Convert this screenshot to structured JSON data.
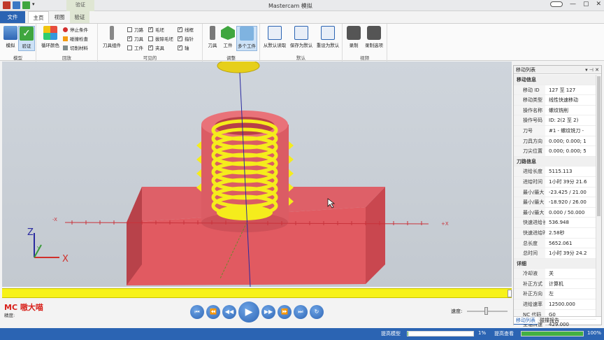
{
  "window": {
    "title": "Mastercam 模拟",
    "context_tab": "验证",
    "controls": [
      "—",
      "▢",
      "✕"
    ]
  },
  "tabs": [
    {
      "label": "文件"
    },
    {
      "label": "主页"
    },
    {
      "label": "视图"
    },
    {
      "label": "验证"
    }
  ],
  "ribbon": {
    "model": {
      "group_label": "模型",
      "simulate": "模拟",
      "verify": "验证"
    },
    "playback": {
      "group_label": "回放",
      "cycle_color": "循环颜色",
      "stop_conditions": "停止条件",
      "collision_check": "碰撞检查",
      "cut_material": "切削材料"
    },
    "visible": {
      "group_label": "可见的",
      "toolpath_component": "刀具组件",
      "checks": [
        {
          "label": "刀路",
          "on": false
        },
        {
          "label": "刀具",
          "on": true
        },
        {
          "label": "工件",
          "on": false
        },
        {
          "label": "毛坯",
          "on": true
        },
        {
          "label": "拔除毛坯",
          "on": false
        },
        {
          "label": "夹具",
          "on": true
        },
        {
          "label": "线框",
          "on": true
        },
        {
          "label": "指针",
          "on": true
        },
        {
          "label": "轴",
          "on": true
        }
      ]
    },
    "adjust": {
      "group_label": "调整",
      "tool": "刀具",
      "workpiece": "工件",
      "multi": "多个工件"
    },
    "defaults": {
      "group_label": "默认",
      "load": "从默认读取",
      "save": "保存为默认",
      "reset": "重设为默认"
    },
    "video": {
      "group_label": "视频",
      "record": "录制",
      "record_options": "录制选项"
    }
  },
  "viewport": {
    "axis_x": "X",
    "axis_y": "Y",
    "axis_z": "Z",
    "plus_x": "+X",
    "minus_x": "-X"
  },
  "colors": {
    "stock": "#e05a62",
    "thread": "#f5ec1c",
    "accent": "#2b64b3"
  },
  "playback": {
    "logo": "MC 嗷大喵",
    "precision_label": "精度:",
    "speed_label": "速度:",
    "buttons": [
      "⏮",
      "⏪",
      "◀◀",
      "▶",
      "▶▶",
      "⏩",
      "⏭",
      "↻"
    ],
    "progress": 1.0,
    "speed": 0.45
  },
  "panel": {
    "title": "移动列表",
    "rows": [
      {
        "section": "移动信息"
      },
      {
        "k": "移动 ID",
        "v": "127 至 127"
      },
      {
        "k": "移动类型",
        "v": "线性快速移动"
      },
      {
        "k": "操作名称",
        "v": "螺纹铣削"
      },
      {
        "k": "操作号码",
        "v": "ID: 2(2 至 2)"
      },
      {
        "k": "刀号",
        "v": "#1 - 螺纹铣刀 -"
      },
      {
        "k": "刀具方向",
        "v": "0.000; 0.000; 1"
      },
      {
        "k": "刀尖位置",
        "v": "0.000; 0.000; 5"
      },
      {
        "section": "刀路信息"
      },
      {
        "k": "进给长度",
        "v": "5115.113"
      },
      {
        "k": "进给时间",
        "v": "1小时 39分 21.6"
      },
      {
        "k": "最小/最大 X",
        "v": "-23.425 / 21.00"
      },
      {
        "k": "最小/最大 Y",
        "v": "-18.920 / 26.00"
      },
      {
        "k": "最小/最大 Z",
        "v": "0.000 / 50.000"
      },
      {
        "k": "快速进给长度",
        "v": "536.948"
      },
      {
        "k": "快速进给时间",
        "v": "2.58秒"
      },
      {
        "k": "总长度",
        "v": "5652.061"
      },
      {
        "k": "总时间",
        "v": "1小时 39分 24.2"
      },
      {
        "section": "详细"
      },
      {
        "k": "冷却液",
        "v": "关"
      },
      {
        "k": "补正方式",
        "v": "计算机"
      },
      {
        "k": "补正方向",
        "v": "左"
      },
      {
        "k": "进给速率",
        "v": "12500.000"
      },
      {
        "k": "NC 代码",
        "v": "G0"
      },
      {
        "k": "主轴转速",
        "v": "429.000"
      }
    ],
    "bottom_tabs": [
      "移动列表",
      "碰撞报告"
    ]
  },
  "status": {
    "build_model": "提高模型",
    "build_pct": "1%",
    "build_value": 0.01,
    "improve_view": "提高查看",
    "improve_pct": "100%",
    "improve_value": 1.0
  }
}
